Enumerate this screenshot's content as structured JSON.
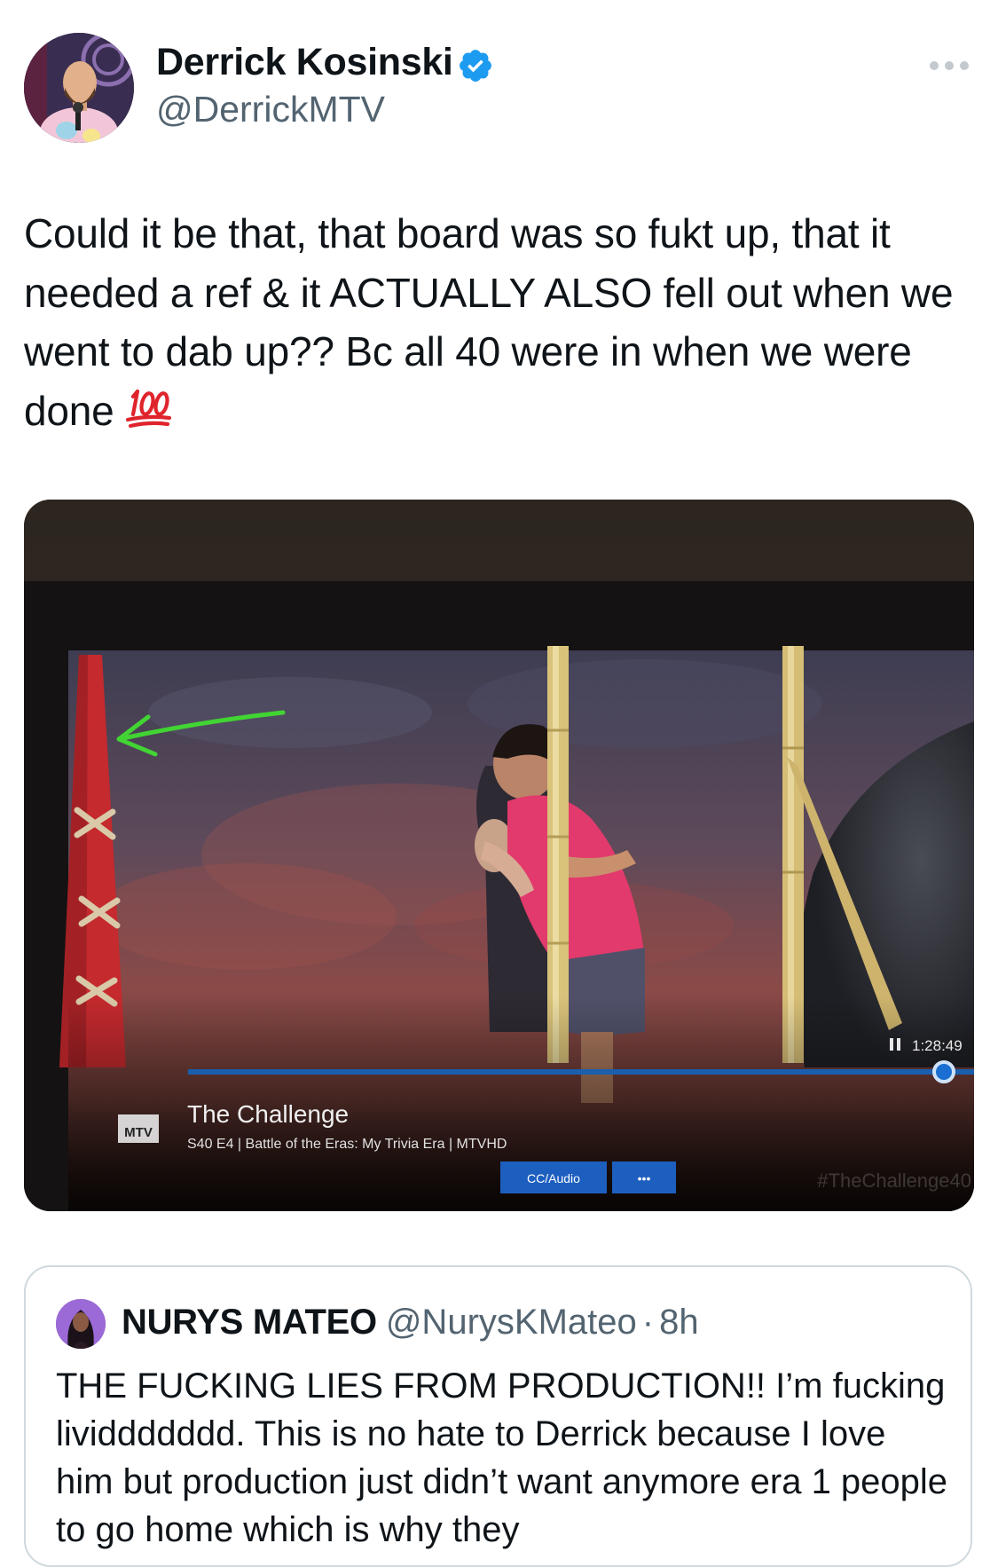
{
  "tweet": {
    "author": {
      "name": "Derrick Kosinski",
      "handle": "@DerrickMTV",
      "verified": true,
      "avatar_icon": "profile-photo"
    },
    "text": "Could it be that, that board was so fukt up, that it needed a ref & it ACTUALLY ALSO fell out when we went to dab up?? Bc all 40 were in when we were done",
    "emoji": "100-points-emoji",
    "more_icon": "more-horizontal-icon",
    "media": {
      "description_icon": "photo-of-tv-screen",
      "tv_overlay": {
        "show_title": "The Challenge",
        "episode_info": "S40 E4 | Battle of the Eras: My Trivia Era | MTVHD",
        "time": "1:28:49",
        "cc_button": "CC/Audio",
        "more_button": "•••",
        "network_logo": "MTV",
        "watermark": "#TheChallenge40"
      }
    }
  },
  "quoted_tweet": {
    "name": "NURYS MATEO",
    "handle": "@NurysKMateo",
    "separator": "·",
    "time": "8h",
    "text": "THE FUCKING LIES FROM PRODUCTION!! I’m fucking lividdddddd. This is no hate to Derrick because I love him but production just didn’t want anymore era 1 people to go home which is why they"
  },
  "colors": {
    "text_primary": "#0f1419",
    "text_secondary": "#536471",
    "verified_blue": "#1d9bf0",
    "border": "#cfd9de",
    "emoji_red": "#e0242c"
  }
}
